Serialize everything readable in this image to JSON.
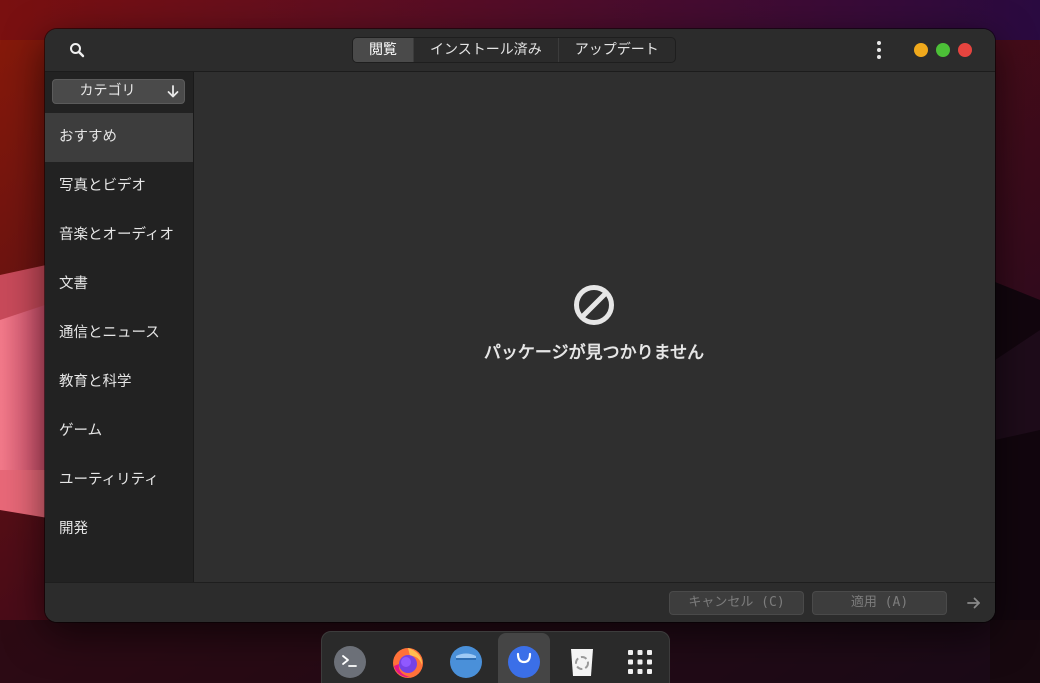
{
  "header": {
    "tabs": [
      {
        "label": "閲覧",
        "active": true
      },
      {
        "label": "インストール済み",
        "active": false
      },
      {
        "label": "アップデート",
        "active": false
      }
    ]
  },
  "sidebar": {
    "dropdown_label": "カテゴリ",
    "items": [
      {
        "label": "おすすめ",
        "selected": true
      },
      {
        "label": "写真とビデオ"
      },
      {
        "label": "音楽とオーディオ"
      },
      {
        "label": "文書"
      },
      {
        "label": "通信とニュース"
      },
      {
        "label": "教育と科学"
      },
      {
        "label": "ゲーム"
      },
      {
        "label": "ユーティリティ"
      },
      {
        "label": "開発"
      }
    ]
  },
  "content": {
    "empty_message": "パッケージが見つかりません"
  },
  "footer": {
    "cancel_label": "キャンセル (C)",
    "apply_label": "適用 (A)"
  },
  "dock": {
    "items": [
      "terminal-icon",
      "firefox-icon",
      "files-icon",
      "software-store-icon",
      "trash-icon",
      "app-grid-icon"
    ]
  },
  "colors": {
    "minimize": "#f0a91c",
    "maximize": "#4cc037",
    "close": "#e6443f",
    "window_bg": "#2f2f2f",
    "sidebar_bg": "#222222"
  }
}
